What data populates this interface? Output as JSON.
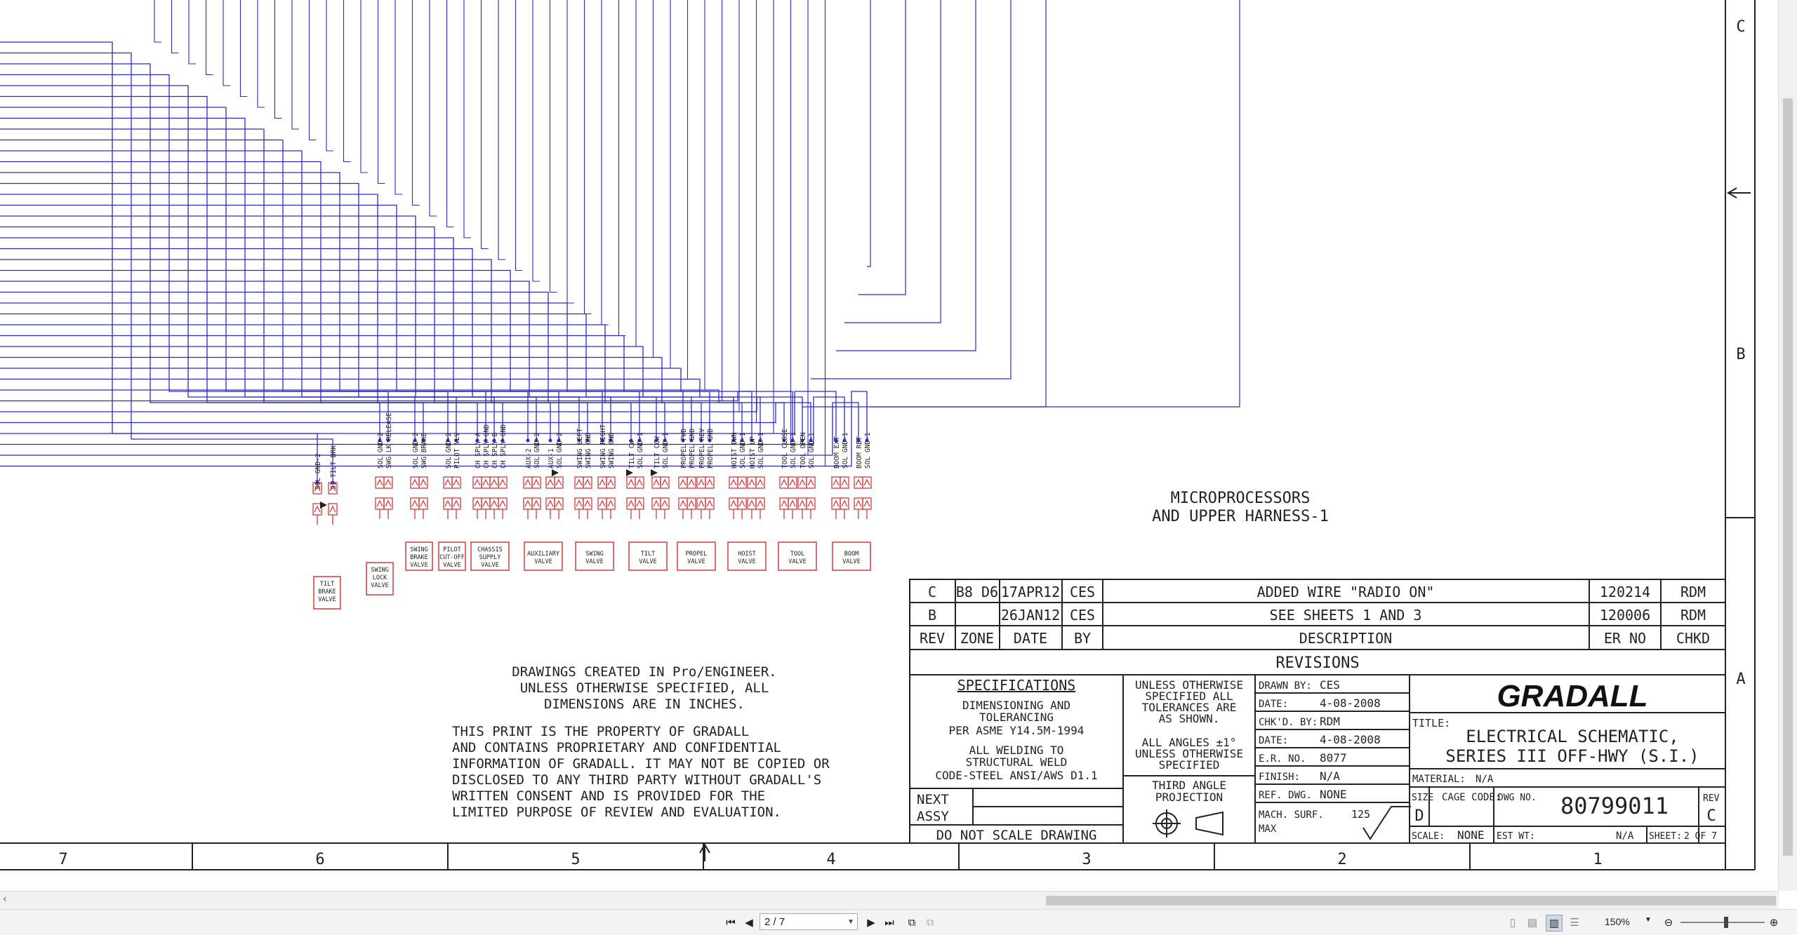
{
  "wiring_color": "#2a2ac8",
  "valve_color": "#d63a3a",
  "border_zones": {
    "bottom": [
      "7",
      "6",
      "5",
      "4",
      "3",
      "2",
      "1"
    ],
    "right": [
      "C",
      "B",
      "A"
    ]
  },
  "pin_labels": [
    "SOL GND-2",
    "SI TILT BRK",
    "SOL GND-2",
    "SWG LK RELEASE",
    "SOL GND-2",
    "SWG BRAKE",
    "SOL GND-2",
    "PILOT VLV",
    "CH SPLY A",
    "CH SPLY GND",
    "CH SPLY B",
    "CH SPLY GND",
    "AUX-2",
    "SOL GND-2",
    "AUX-1",
    "SOL GND-2",
    "SWING LEFT",
    "SWING GND",
    "SWING RIGHT",
    "SWING GND",
    "TILT CW",
    "SOL GND-1",
    "TILT CCW",
    "SOL GND-1",
    "PROPEL FWD",
    "PROPEL GND",
    "PROPEL REV",
    "PROPEL GND",
    "HOIST DWN",
    "SOL GND-1",
    "HOIST UP",
    "SOL GND-1",
    "TOOL CLOSE",
    "SOL GND-1",
    "TOOL OPEN",
    "SOL GND-1",
    "BOOM EXT",
    "SOL GND-1",
    "BOOM RET",
    "SOL GND-1"
  ],
  "valves": [
    {
      "lines": [
        "TILT",
        "BRAKE",
        "VALVE"
      ]
    },
    {
      "lines": [
        "SWING",
        "LOCK",
        "VALVE"
      ]
    },
    {
      "lines": [
        "SWING",
        "BRAKE",
        "VALVE"
      ]
    },
    {
      "lines": [
        "PILOT",
        "CUT-OFF",
        "VALVE"
      ]
    },
    {
      "lines": [
        "CHASSIS",
        "SUPPLY",
        "VALVE"
      ]
    },
    {
      "lines": [
        "AUXILIARY",
        "VALVE"
      ]
    },
    {
      "lines": [
        "SWING",
        "VALVE"
      ]
    },
    {
      "lines": [
        "TILT",
        "VALVE"
      ]
    },
    {
      "lines": [
        "PROPEL",
        "VALVE"
      ]
    },
    {
      "lines": [
        "HOIST",
        "VALVE"
      ]
    },
    {
      "lines": [
        "TOOL",
        "VALVE"
      ]
    },
    {
      "lines": [
        "BOOM",
        "VALVE"
      ]
    }
  ],
  "sheet_title": [
    "MICROPROCESSORS",
    "AND UPPER HARNESS-1"
  ],
  "notes": {
    "created": [
      "DRAWINGS CREATED IN Pro/ENGINEER.",
      "UNLESS OTHERWISE SPECIFIED, ALL",
      "DIMENSIONS ARE IN INCHES."
    ],
    "property": [
      "THIS PRINT IS THE PROPERTY OF GRADALL",
      "AND CONTAINS PROPRIETARY AND CONFIDENTIAL",
      "INFORMATION OF GRADALL. IT MAY NOT BE COPIED OR",
      "DISCLOSED TO ANY THIRD PARTY WITHOUT GRADALL'S",
      "WRITTEN CONSENT AND IS PROVIDED FOR THE",
      "LIMITED PURPOSE OF REVIEW AND EVALUATION."
    ]
  },
  "revisions": {
    "rows": [
      {
        "rev": "C",
        "zone": "B8 D6",
        "date": "17APR12",
        "by": "CES",
        "description": "ADDED WIRE \"RADIO ON\"",
        "er_no": "120214",
        "chkd": "RDM"
      },
      {
        "rev": "B",
        "zone": "",
        "date": "26JAN12",
        "by": "CES",
        "description": "SEE SHEETS 1 AND 3",
        "er_no": "120006",
        "chkd": "RDM"
      }
    ],
    "headers": {
      "rev": "REV",
      "zone": "ZONE",
      "date": "DATE",
      "by": "BY",
      "description": "DESCRIPTION",
      "er_no": "ER NO",
      "chkd": "CHKD"
    },
    "title": "REVISIONS"
  },
  "title_block": {
    "spec_title": "SPECIFICATIONS",
    "spec_lines": [
      "DIMENSIONING AND",
      "TOLERANCING",
      "PER ASME Y14.5M-1994",
      "ALL WELDING TO",
      "STRUCTURAL WELD",
      "CODE-STEEL ANSI/AWS D1.1"
    ],
    "next": "NEXT",
    "assy": "ASSY",
    "do_not_scale": "DO NOT SCALE DRAWING",
    "tolerance_lines": [
      "UNLESS OTHERWISE",
      "SPECIFIED ALL",
      "TOLERANCES ARE",
      "AS SHOWN.",
      "ALL ANGLES ±1°",
      "UNLESS OTHERWISE",
      "SPECIFIED"
    ],
    "projection": [
      "THIRD ANGLE",
      "PROJECTION"
    ],
    "drawn_by_label": "DRAWN BY:",
    "drawn_by": "CES",
    "date1_label": "DATE:",
    "date1": "4-08-2008",
    "chkd_by_label": "CHK'D. BY:",
    "chkd_by": "RDM",
    "date2_label": "DATE:",
    "date2": "4-08-2008",
    "er_no_label": "E.R. NO.",
    "er_no": "8077",
    "finish_label": "FINISH:",
    "finish": "N/A",
    "ref_dwg_label": "REF. DWG.",
    "ref_dwg": "NONE",
    "mach_surf_label": "MACH. SURF.",
    "mach_surf": "125",
    "max": "MAX",
    "company": "GRADALL",
    "title_label": "TITLE:",
    "title_lines": [
      "ELECTRICAL SCHEMATIC,",
      "SERIES III OFF-HWY (S.I.)"
    ],
    "material_label": "MATERIAL:",
    "material": "N/A",
    "size_label": "SIZE",
    "size": "D",
    "cage_label": "CAGE CODE:",
    "dwg_no_label": "DWG NO.",
    "dwg_no": "80799011",
    "rev_label": "REV",
    "rev": "C",
    "scale_label": "SCALE:",
    "scale": "NONE",
    "est_wt_label": "EST WT:",
    "est_wt": "N/A",
    "sheet_label": "SHEET:",
    "sheet": "2 OF 7"
  },
  "viewer": {
    "page_indicator": "2 / 7",
    "zoom": "150%"
  }
}
